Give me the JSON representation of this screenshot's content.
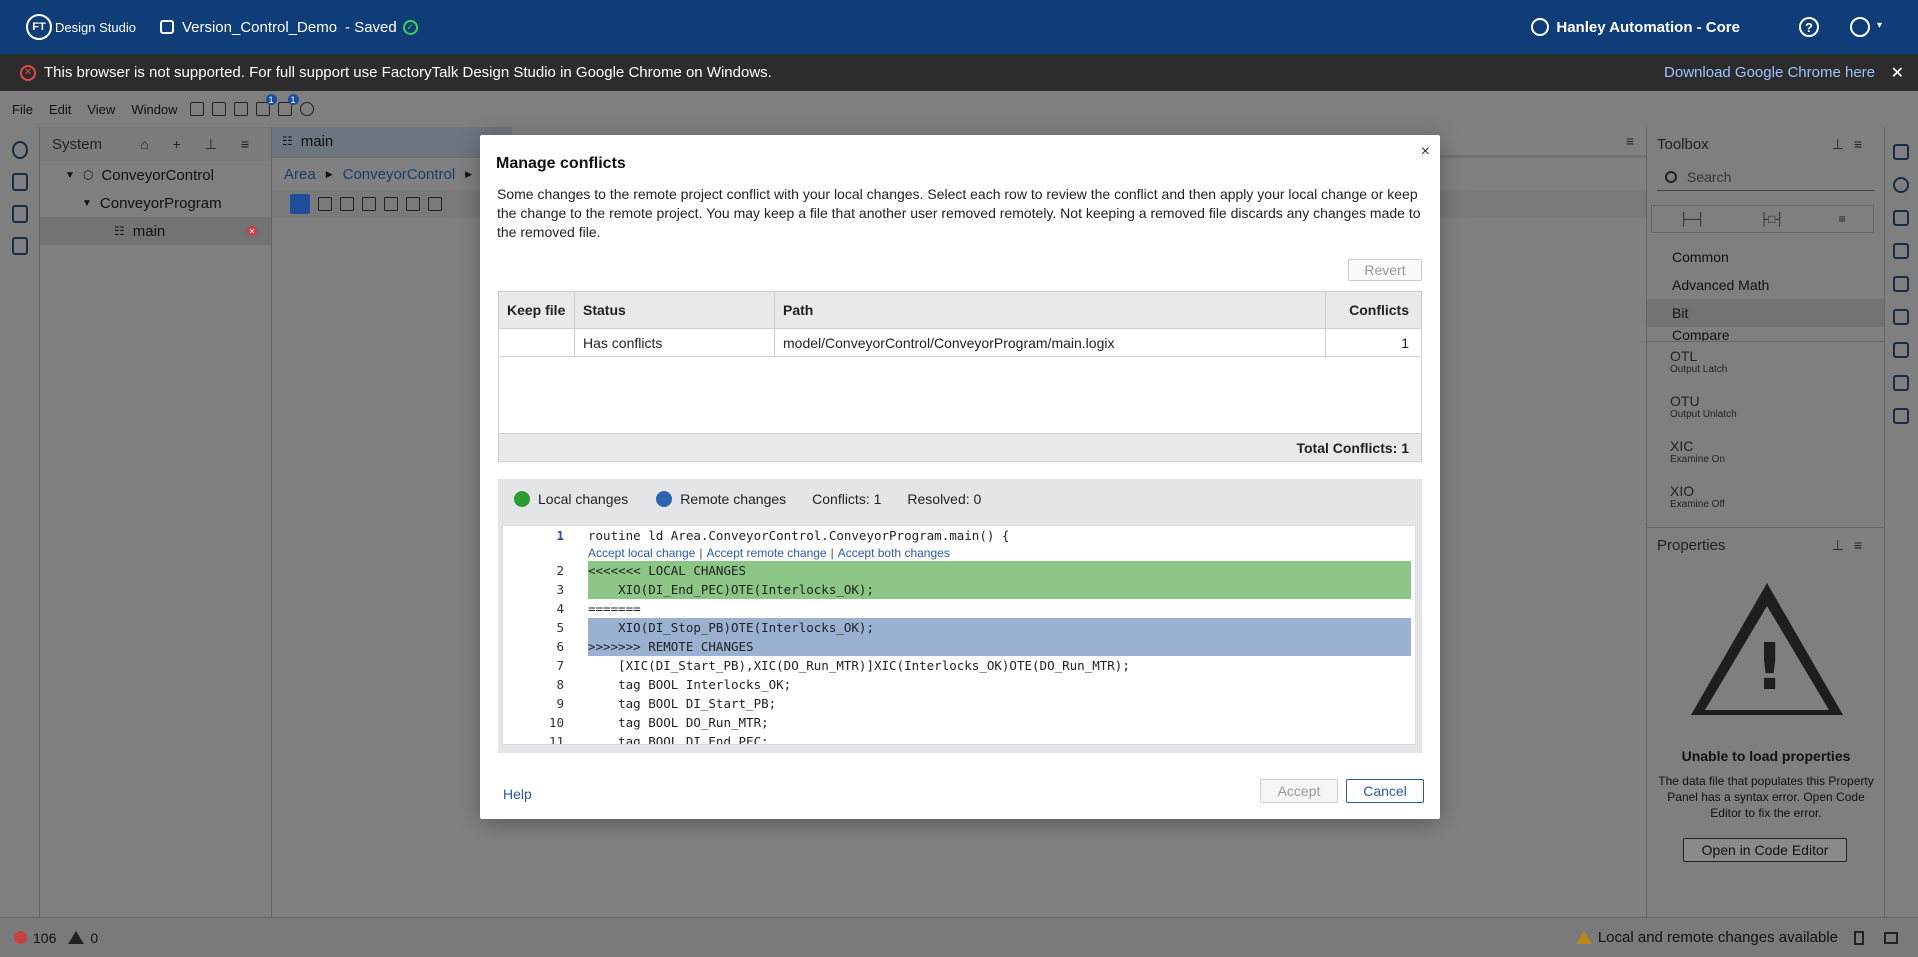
{
  "app": {
    "logo_text": "FT",
    "logo_name": "Design Studio",
    "project_name": "Version_Control_Demo",
    "save_state": "- Saved",
    "org_name": "Hanley Automation - Core",
    "help_glyph": "?"
  },
  "warning": {
    "message": "This browser is not supported. For full support use FactoryTalk Design Studio in Google Chrome on Windows.",
    "link": "Download Google Chrome here",
    "close": "✕"
  },
  "menu": {
    "file": "File",
    "edit": "Edit",
    "view": "View",
    "window": "Window",
    "badge_push": "1",
    "badge_pull": "1"
  },
  "system": {
    "title": "System",
    "tree": [
      {
        "label": "ConveyorControl"
      },
      {
        "label": "ConveyorProgram"
      },
      {
        "label": "main"
      }
    ]
  },
  "editor": {
    "tab": "main",
    "breadcrumb": [
      "Area",
      "ConveyorControl"
    ]
  },
  "toolbox": {
    "title": "Toolbox",
    "search_placeholder": "Search",
    "categories": [
      "Common",
      "Advanced Math",
      "Bit",
      "Compare"
    ],
    "items": [
      {
        "name": "OTL",
        "desc": "Output Latch"
      },
      {
        "name": "OTU",
        "desc": "Output Unlatch"
      },
      {
        "name": "XIC",
        "desc": "Examine On"
      },
      {
        "name": "XIO",
        "desc": "Examine Off"
      }
    ]
  },
  "properties": {
    "title": "Properties",
    "error_title": "Unable to load properties",
    "error_text": "The data file that populates this Property Panel has a syntax error. Open Code Editor to fix the error.",
    "open_button": "Open in Code Editor"
  },
  "status": {
    "errors": "106",
    "warnings": "0",
    "message": "Local and remote changes available"
  },
  "dialog": {
    "title": "Manage conflicts",
    "close": "×",
    "description": "Some changes to the remote project conflict with your local changes. Select each row to review the conflict and then apply your local change or keep the change to the remote project. You may keep a file that another user removed remotely. Not keeping a removed file discards any changes made to the removed file.",
    "revert": "Revert",
    "columns": {
      "keep": "Keep file",
      "status": "Status",
      "path": "Path",
      "conflicts": "Conflicts"
    },
    "rows": [
      {
        "keep": "",
        "status": "Has conflicts",
        "path": "model/ConveyorControl/ConveyorProgram/main.logix",
        "conflicts": "1"
      }
    ],
    "total": "Total Conflicts: 1",
    "legend": {
      "local": "Local changes",
      "remote": "Remote changes",
      "conflicts": "Conflicts: 1",
      "resolved": "Resolved: 0",
      "local_color": "#2e9b2e",
      "remote_color": "#2d62b0"
    },
    "code_actions": {
      "accept_local": "Accept local change",
      "accept_remote": "Accept remote change",
      "accept_both": "Accept both changes",
      "sep": "|"
    },
    "code_lines": [
      {
        "n": "1",
        "t": "routine ld Area.ConveyorControl.ConveyorProgram.main() {"
      },
      {
        "n": "2",
        "t": "<<<<<<< LOCAL CHANGES"
      },
      {
        "n": "3",
        "t": "    XIO(DI_End_PEC)OTE(Interlocks_OK);"
      },
      {
        "n": "4",
        "t": "======="
      },
      {
        "n": "5",
        "t": "    XIO(DI_Stop_PB)OTE(Interlocks_OK);"
      },
      {
        "n": "6",
        "t": ">>>>>>> REMOTE CHANGES"
      },
      {
        "n": "7",
        "t": "    [XIC(DI_Start_PB),XIC(DO_Run_MTR)]XIC(Interlocks_OK)OTE(DO_Run_MTR);"
      },
      {
        "n": "8",
        "t": "    tag BOOL Interlocks_OK;"
      },
      {
        "n": "9",
        "t": "    tag BOOL DI_Start_PB;"
      },
      {
        "n": "10",
        "t": "    tag BOOL DO_Run_MTR;"
      },
      {
        "n": "11",
        "t": "    tag BOOL DI_End_PEC;"
      }
    ],
    "help": "Help",
    "accept": "Accept",
    "cancel": "Cancel"
  }
}
